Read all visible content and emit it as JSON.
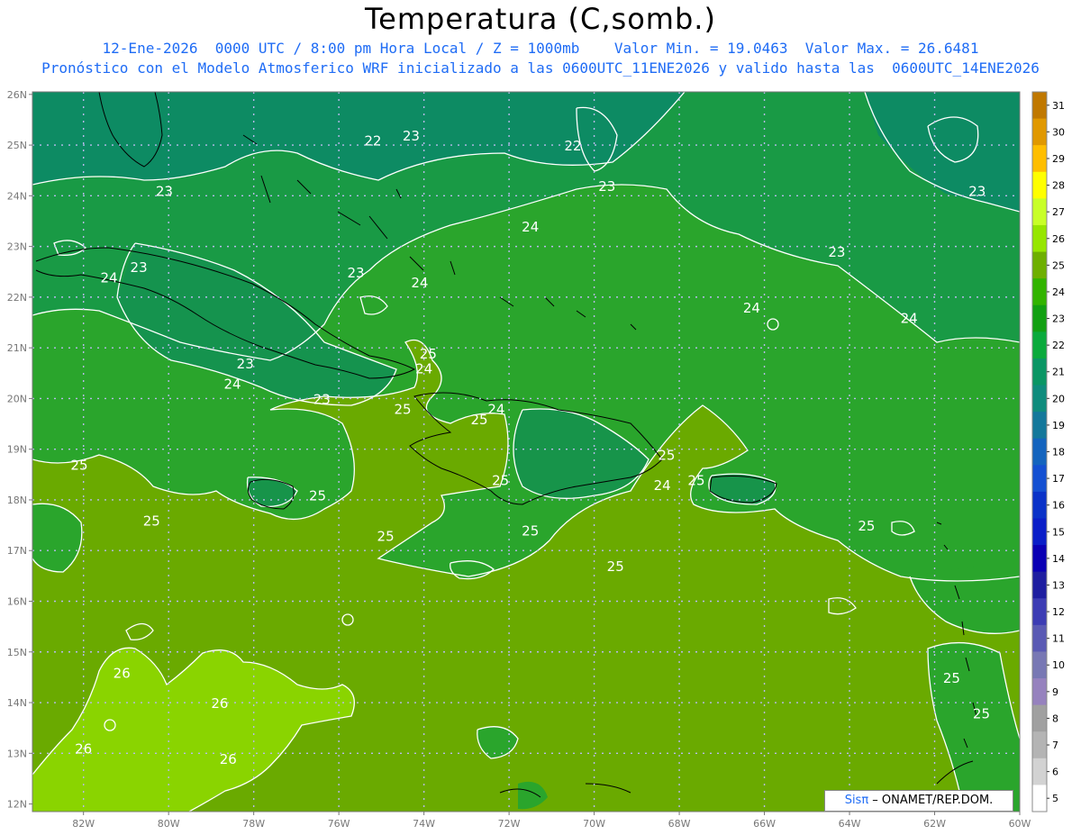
{
  "header": {
    "title": "Temperatura (C,somb.)",
    "line1": "12-Ene-2026  0000 UTC / 8:00 pm Hora Local / Z = 1000mb    Valor Min. = 19.0463  Valor Max. = 26.6481",
    "line2": "Pronóstico con el Modelo Atmosferico WRF inicializado a las 0600UTC_11ENE2026 y valido hasta las  0600UTC_14ENE2026"
  },
  "map": {
    "lat_labels": [
      "26N",
      "25N",
      "24N",
      "23N",
      "22N",
      "21N",
      "20N",
      "19N",
      "18N",
      "17N",
      "16N",
      "15N",
      "14N",
      "13N",
      "12N"
    ],
    "lon_labels": [
      "82W",
      "80W",
      "78W",
      "76W",
      "74W",
      "72W",
      "70W",
      "68W",
      "66W",
      "64W",
      "62W",
      "60W"
    ],
    "contour_labels": [
      {
        "text": "22",
        "lon": -75.2,
        "lat": 25.1
      },
      {
        "text": "23",
        "lon": -74.3,
        "lat": 25.2
      },
      {
        "text": "22",
        "lon": -70.5,
        "lat": 25.0
      },
      {
        "text": "23",
        "lon": -69.7,
        "lat": 24.2
      },
      {
        "text": "23",
        "lon": -80.1,
        "lat": 24.1
      },
      {
        "text": "23",
        "lon": -61.0,
        "lat": 24.1
      },
      {
        "text": "24",
        "lon": -71.5,
        "lat": 23.4
      },
      {
        "text": "23",
        "lon": -64.3,
        "lat": 22.9
      },
      {
        "text": "23",
        "lon": -80.7,
        "lat": 22.6
      },
      {
        "text": "24",
        "lon": -81.4,
        "lat": 22.4
      },
      {
        "text": "23",
        "lon": -75.6,
        "lat": 22.5
      },
      {
        "text": "24",
        "lon": -74.1,
        "lat": 22.3
      },
      {
        "text": "24",
        "lon": -66.3,
        "lat": 21.8
      },
      {
        "text": "24",
        "lon": -62.6,
        "lat": 21.6
      },
      {
        "text": "25",
        "lon": -73.9,
        "lat": 20.9
      },
      {
        "text": "23",
        "lon": -78.2,
        "lat": 20.7
      },
      {
        "text": "24",
        "lon": -74.0,
        "lat": 20.6
      },
      {
        "text": "24",
        "lon": -78.5,
        "lat": 20.3
      },
      {
        "text": "23",
        "lon": -76.4,
        "lat": 20.0
      },
      {
        "text": "25",
        "lon": -74.5,
        "lat": 19.8
      },
      {
        "text": "24",
        "lon": -72.3,
        "lat": 19.8
      },
      {
        "text": "25",
        "lon": -72.7,
        "lat": 19.6
      },
      {
        "text": "25",
        "lon": -68.3,
        "lat": 18.9
      },
      {
        "text": "25",
        "lon": -82.1,
        "lat": 18.7
      },
      {
        "text": "25",
        "lon": -72.2,
        "lat": 18.4
      },
      {
        "text": "25",
        "lon": -67.6,
        "lat": 18.4
      },
      {
        "text": "24",
        "lon": -68.4,
        "lat": 18.3
      },
      {
        "text": "25",
        "lon": -76.5,
        "lat": 18.1
      },
      {
        "text": "25",
        "lon": -80.4,
        "lat": 17.6
      },
      {
        "text": "25",
        "lon": -71.5,
        "lat": 17.4
      },
      {
        "text": "25",
        "lon": -74.9,
        "lat": 17.3
      },
      {
        "text": "25",
        "lon": -63.6,
        "lat": 17.5
      },
      {
        "text": "25",
        "lon": -69.5,
        "lat": 16.7
      },
      {
        "text": "26",
        "lon": -81.1,
        "lat": 14.6
      },
      {
        "text": "25",
        "lon": -61.6,
        "lat": 14.5
      },
      {
        "text": "26",
        "lon": -78.8,
        "lat": 14.0
      },
      {
        "text": "25",
        "lon": -60.9,
        "lat": 13.8
      },
      {
        "text": "26",
        "lon": -82.0,
        "lat": 13.1
      },
      {
        "text": "26",
        "lon": -78.6,
        "lat": 12.9
      }
    ]
  },
  "colorbar": {
    "labels": [
      "31",
      "30",
      "29",
      "28",
      "27",
      "26",
      "25",
      "24",
      "23",
      "22",
      "21",
      "20",
      "19",
      "18",
      "17",
      "16",
      "15",
      "14",
      "13",
      "12",
      "11",
      "10",
      "9",
      "8",
      "7",
      "6",
      "5"
    ],
    "colors": [
      "#c07800",
      "#e09800",
      "#ffbe00",
      "#ffff00",
      "#c8ff28",
      "#96e600",
      "#6eaf00",
      "#32b400",
      "#12a012",
      "#0aaa3c",
      "#0a9664",
      "#0f8c7d",
      "#14789b",
      "#1464be",
      "#1450d2",
      "#0a32c8",
      "#0a1ec8",
      "#0a00b4",
      "#1e1ea0",
      "#3c3cb4",
      "#5a5ab4",
      "#7878b4",
      "#9682be",
      "#a0a0a0",
      "#b4b4b4",
      "#d2d2d2",
      "#ffffff"
    ]
  },
  "credit": {
    "sis": "Sisπ",
    "text": " – ONAMET/REP.DOM."
  },
  "colors": {
    "deep": "#0a8a62",
    "mid": "#1a9a3c",
    "green": "#2aa52c",
    "olive": "#6aaa00",
    "light": "#8ad400",
    "grid": "#b9b9ee"
  }
}
